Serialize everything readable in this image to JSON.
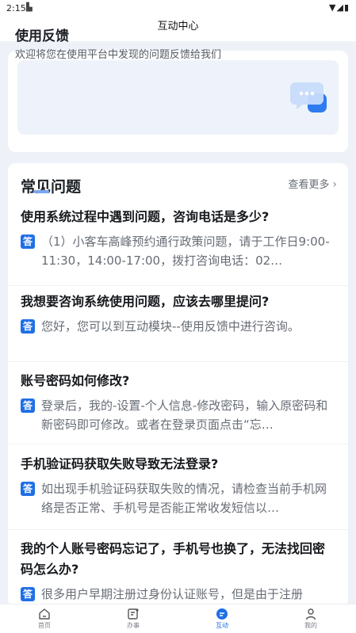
{
  "status": {
    "time": "2:15",
    "sim_icon": "sim-card-icon",
    "indicators": "wifi signal battery"
  },
  "header": {
    "title": "互动中心"
  },
  "feedback": {
    "title": "使用反馈",
    "description": "欢迎将您在使用平台中发现的问题反馈给我们",
    "icon": "chat-bubble-icon",
    "accent": "#2f7bf0"
  },
  "faq": {
    "title": "常见问题",
    "more": "查看更多",
    "answer_badge": "答",
    "items": [
      {
        "question": "使用系统过程中遇到问题，咨询电话是多少?",
        "answer": "（1）小客车高峰预约通行政策问题，请于工作日9:00-11:30，14:00-17:00，拨打咨询电话：02…"
      },
      {
        "question": "我想要咨询系统使用问题，应该去哪里提问?",
        "answer": "您好，您可以到互动模块--使用反馈中进行咨询。"
      },
      {
        "question": "账号密码如何修改?",
        "answer": "登录后，我的-设置-个人信息-修改密码，输入原密码和新密码即可修改。或者在登录页面点击“忘…"
      },
      {
        "question": "手机验证码获取失败导致无法登录?",
        "answer": "如出现手机验证码获取失败的情况，请检查当前手机网络是否正常、手机号是否能正常收发短信以…"
      },
      {
        "question": "我的个人账号密码忘记了，手机号也换了，无法找回密码怎么办?",
        "answer": "很多用户早期注册过身份认证账号，但是由于注册"
      }
    ]
  },
  "nav": {
    "active_color": "#1f6fe6",
    "items": [
      {
        "label": "首页",
        "icon": "home-icon"
      },
      {
        "label": "办事",
        "icon": "tasks-icon"
      },
      {
        "label": "互动",
        "icon": "message-icon"
      },
      {
        "label": "我的",
        "icon": "user-icon"
      }
    ]
  }
}
